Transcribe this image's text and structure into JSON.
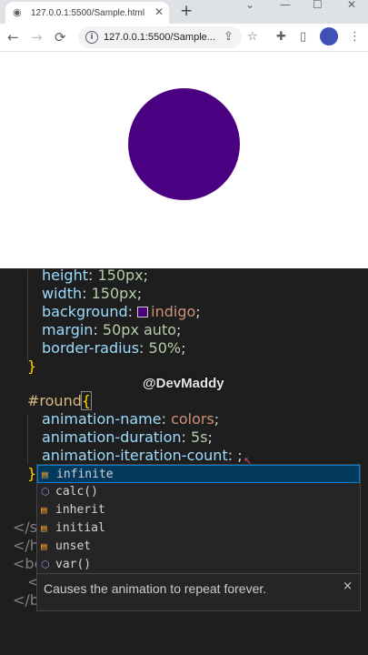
{
  "browser": {
    "tab_title": "127.0.0.1:5500/Sample.html",
    "tab_close": "✕",
    "new_tab": "+",
    "window_controls": [
      "⌄",
      "—",
      "☐",
      "✕"
    ],
    "nav": {
      "back": "←",
      "forward": "→",
      "reload": "⟳"
    },
    "address": "127.0.0.1:5500/Sample...",
    "toolbar_icons": {
      "share": "⇪",
      "star": "☆",
      "extensions": "✚",
      "sidepanel": "▯",
      "menu": "⋮"
    }
  },
  "page": {
    "circle_color": "#4b0082"
  },
  "watermark": "@DevMaddy",
  "code": {
    "line1": {
      "prop": "height",
      "value": "150px"
    },
    "line2": {
      "prop": "width",
      "value": "150px"
    },
    "line3": {
      "prop": "background",
      "value": "indigo"
    },
    "line4": {
      "prop": "margin",
      "value": "50px auto"
    },
    "line5": {
      "prop": "border-radius",
      "value": "50%"
    },
    "close_brace": "}",
    "selector": "#round",
    "open_brace": "{",
    "line6": {
      "prop": "animation-name",
      "value": "colors"
    },
    "line7": {
      "prop": "animation-duration",
      "value": "5s"
    },
    "line8": {
      "prop": "animation-iteration-count",
      "value": ";"
    },
    "closing_tags": [
      "</st",
      "</he",
      "<bod",
      "<",
      "</bo"
    ]
  },
  "suggest": {
    "items": [
      {
        "label": "infinite",
        "kind": "value"
      },
      {
        "label": "calc()",
        "kind": "function"
      },
      {
        "label": "inherit",
        "kind": "value"
      },
      {
        "label": "initial",
        "kind": "value"
      },
      {
        "label": "unset",
        "kind": "value"
      },
      {
        "label": "var()",
        "kind": "function"
      }
    ],
    "details": "Causes the animation to repeat forever.",
    "details_close": "×"
  }
}
